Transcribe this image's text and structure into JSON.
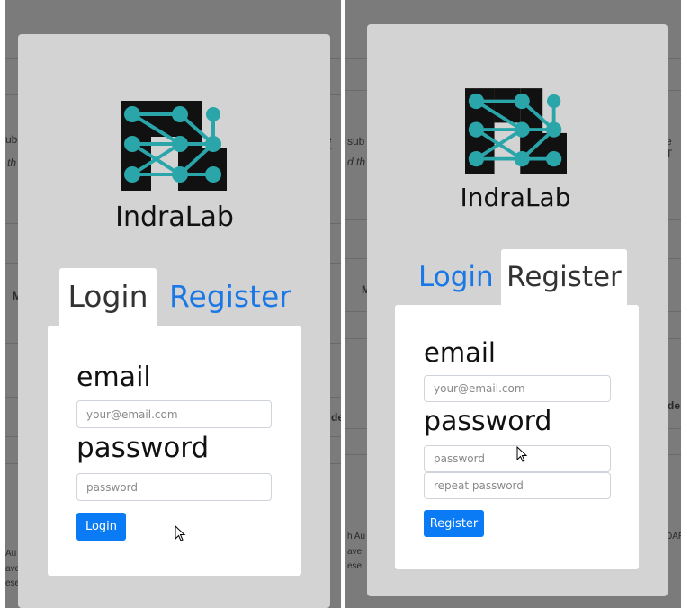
{
  "colors": {
    "accent": "#0a7bf5",
    "link": "#1a78e6",
    "overlay": "#7b7b7b",
    "modal": "#d3d3d3",
    "logo_teal": "#2aa6aa"
  },
  "brand": {
    "name": "IndraLab"
  },
  "left": {
    "tabs": {
      "login": "Login",
      "register": "Register",
      "active": "login"
    },
    "email_label": "email",
    "email_placeholder": "your@email.com",
    "password_label": "password",
    "password_placeholder": "password",
    "submit_label": "Login",
    "background_fragments": [
      "ub",
      "e T",
      "th",
      "M",
      "de",
      "Au",
      "ave",
      "ese"
    ]
  },
  "right": {
    "tabs": {
      "login": "Login",
      "register": "Register",
      "active": "register"
    },
    "email_label": "email",
    "email_placeholder": "your@email.com",
    "password_label": "password",
    "password_placeholder": "password",
    "repeat_placeholder": "repeat password",
    "submit_label": "Register",
    "background_fragments": [
      "sub",
      "e T",
      "d th",
      "M",
      "de",
      "h Au",
      "DAR",
      "ave",
      "ese"
    ]
  }
}
